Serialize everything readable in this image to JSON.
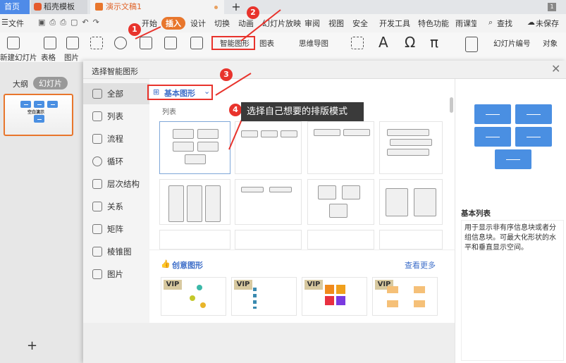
{
  "tabs": [
    {
      "label": "首页"
    },
    {
      "label": "稻壳模板"
    },
    {
      "label": "演示文稿1"
    }
  ],
  "new_tab": "+",
  "window_badge": "1",
  "menu": {
    "file": "文件",
    "items": [
      "开始",
      "插入",
      "设计",
      "切换",
      "动画",
      "幻灯片放映",
      "审阅",
      "视图",
      "安全",
      "开发工具",
      "特色功能",
      "雨课堂"
    ],
    "active": "插入",
    "search": "查找",
    "unsaved": "未保存"
  },
  "ribbon": {
    "new_slide": "新建幻灯片",
    "table": "表格",
    "picture": "图片",
    "smart_art": "智能图形",
    "chart": "图表",
    "mindmap": "思维导图",
    "slide_number": "幻灯片编号",
    "object": "对象"
  },
  "left_pane": {
    "outline": "大纲",
    "slides": "幻灯片",
    "slide_title": "空白演示",
    "add": "+"
  },
  "dialog": {
    "title": "选择智能图形",
    "close": "✕",
    "categories": [
      "全部",
      "列表",
      "流程",
      "循环",
      "层次结构",
      "关系",
      "矩阵",
      "棱锥图",
      "图片"
    ],
    "selected_category": "全部",
    "filter": "基本图形",
    "section": "列表",
    "creative_title": "创意图形",
    "see_more": "查看更多",
    "vip": "VIP",
    "preview_name": "基本列表",
    "preview_desc": "用于显示非有序信息块或者分组信息块。可最大化形状的水平和垂直显示空间。"
  },
  "annotations": {
    "n1": "1",
    "n2": "2",
    "n3": "3",
    "n4": "4",
    "callout": "选择自己想要的排版模式"
  },
  "colors": {
    "accent": "#e8762c",
    "annotation": "#e8332c",
    "preview_block": "#4a8fe2",
    "link": "#3f6fc9"
  }
}
